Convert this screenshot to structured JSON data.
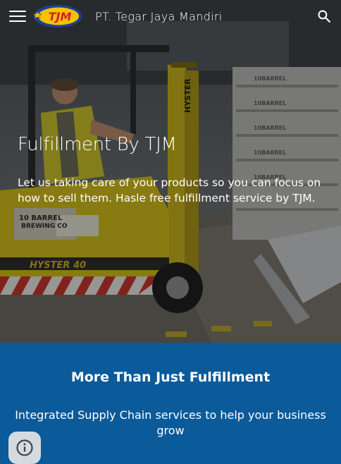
{
  "header": {
    "logo_text": "TJM",
    "site_title": "PT. Tegar Jaya Mandiri",
    "menu_icon": "menu-icon",
    "search_icon": "search-icon"
  },
  "hero": {
    "title": "Fulfillment By TJM",
    "text": "Let us taking care of your products so you can focus on how to sell them. Hasle free fulfillment service by TJM.",
    "image_text": [
      "10 BARREL BREWING CO.",
      "HYSTER",
      "HYSTER 40"
    ]
  },
  "section": {
    "title": "More Than Just Fulfillment",
    "text": "Integrated Supply Chain services to help your business grow"
  },
  "info_button_icon": "info-icon",
  "colors": {
    "band": "#0b5a9a",
    "logo_yellow": "#f5c400",
    "logo_red": "#d6202a",
    "logo_blue": "#1c3f9e",
    "forklift_yellow": "#d8c21a"
  }
}
